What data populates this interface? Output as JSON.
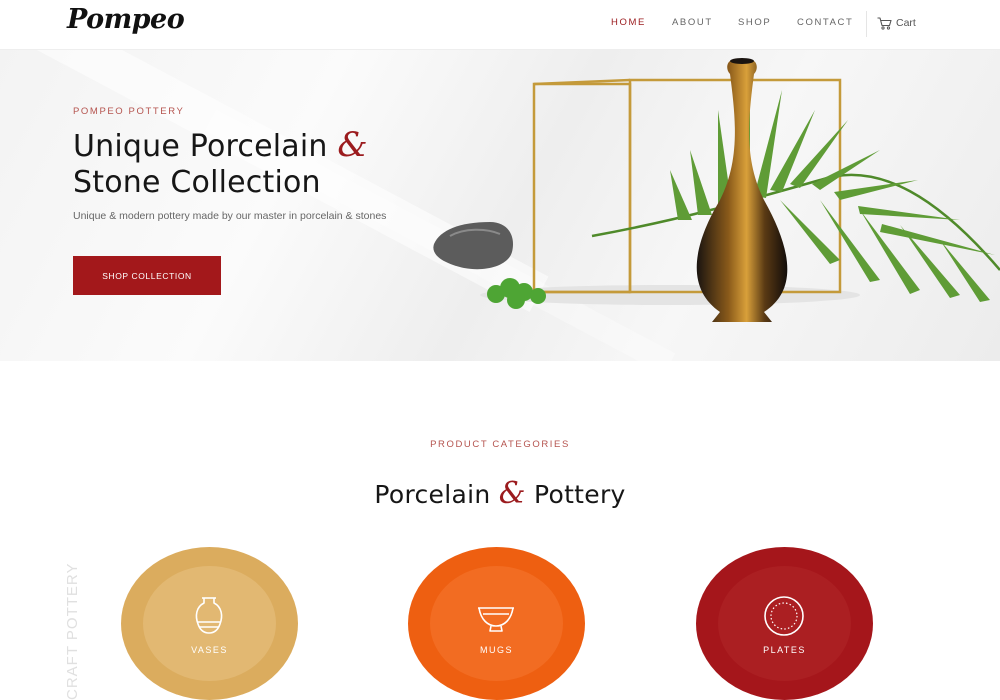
{
  "brand": {
    "logo": "Pompeo"
  },
  "nav": {
    "items": [
      {
        "label": "HOME",
        "active": true
      },
      {
        "label": "ABOUT",
        "active": false
      },
      {
        "label": "SHOP",
        "active": false
      },
      {
        "label": "CONTACT",
        "active": false
      }
    ],
    "cart_label": "Cart",
    "cart_icon": "cart-icon"
  },
  "hero": {
    "eyebrow": "POMPEO POTTERY",
    "title_line1_before": "Unique Porcelain",
    "title_amp": "&",
    "title_line2": "Stone Collection",
    "subtitle": "Unique & modern pottery made by our master in porcelain & stones",
    "cta_label": "SHOP COLLECTION"
  },
  "categories": {
    "eyebrow": "PRODUCT CATEGORIES",
    "title_before": "Porcelain",
    "title_amp": "&",
    "title_after": "Pottery",
    "side_text": "CRAFT POTTERY",
    "items": [
      {
        "label": "VASES",
        "icon": "vase-icon",
        "color": "#dbac5e"
      },
      {
        "label": "MUGS",
        "icon": "bowl-icon",
        "color": "#ee5f11"
      },
      {
        "label": "PLATES",
        "icon": "plate-icon",
        "color": "#a5161b"
      }
    ]
  },
  "colors": {
    "accent": "#9b1b1e",
    "eyebrow": "#b5544f",
    "cta": "#a3181b"
  }
}
